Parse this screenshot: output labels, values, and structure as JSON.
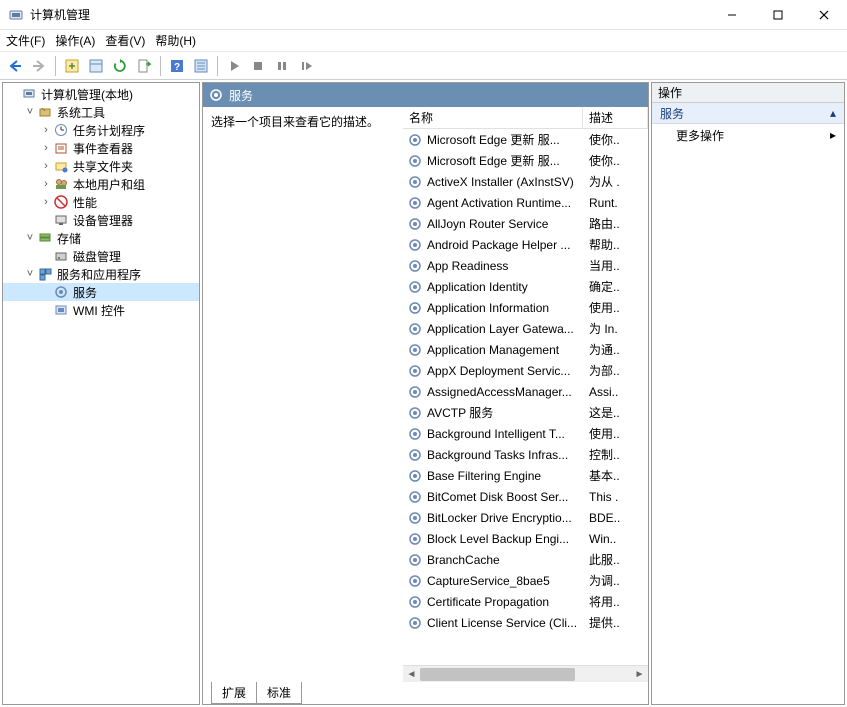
{
  "titlebar": {
    "title": "计算机管理"
  },
  "menu": {
    "file": "文件(F)",
    "action": "操作(A)",
    "view": "查看(V)",
    "help": "帮助(H)"
  },
  "tree": {
    "root": "计算机管理(本地)",
    "sys": "系统工具",
    "task": "任务计划程序",
    "event": "事件查看器",
    "shared": "共享文件夹",
    "users": "本地用户和组",
    "perf": "性能",
    "devmgr": "设备管理器",
    "storage": "存储",
    "disk": "磁盘管理",
    "apps": "服务和应用程序",
    "services": "服务",
    "wmi": "WMI 控件"
  },
  "center": {
    "header": "服务",
    "hint": "选择一个项目来查看它的描述。",
    "col_name": "名称",
    "col_desc": "描述"
  },
  "services": [
    {
      "name": "Microsoft Edge 更新 服...",
      "desc": "使你.."
    },
    {
      "name": "Microsoft Edge 更新 服...",
      "desc": "使你.."
    },
    {
      "name": "ActiveX Installer (AxInstSV)",
      "desc": "为从 ."
    },
    {
      "name": "Agent Activation Runtime...",
      "desc": "Runt."
    },
    {
      "name": "AllJoyn Router Service",
      "desc": "路由.."
    },
    {
      "name": "Android Package Helper ...",
      "desc": "帮助.."
    },
    {
      "name": "App Readiness",
      "desc": "当用.."
    },
    {
      "name": "Application Identity",
      "desc": "确定.."
    },
    {
      "name": "Application Information",
      "desc": "使用.."
    },
    {
      "name": "Application Layer Gatewa...",
      "desc": "为 In."
    },
    {
      "name": "Application Management",
      "desc": "为通.."
    },
    {
      "name": "AppX Deployment Servic...",
      "desc": "为部.."
    },
    {
      "name": "AssignedAccessManager...",
      "desc": "Assi.."
    },
    {
      "name": "AVCTP 服务",
      "desc": "这是.."
    },
    {
      "name": "Background Intelligent T...",
      "desc": "使用.."
    },
    {
      "name": "Background Tasks Infras...",
      "desc": "控制.."
    },
    {
      "name": "Base Filtering Engine",
      "desc": "基本.."
    },
    {
      "name": "BitComet Disk Boost Ser...",
      "desc": "This ."
    },
    {
      "name": "BitLocker Drive Encryptio...",
      "desc": "BDE.."
    },
    {
      "name": "Block Level Backup Engi...",
      "desc": "Win.."
    },
    {
      "name": "BranchCache",
      "desc": "此服.."
    },
    {
      "name": "CaptureService_8bae5",
      "desc": "为调.."
    },
    {
      "name": "Certificate Propagation",
      "desc": "将用.."
    },
    {
      "name": "Client License Service (Cli...",
      "desc": "提供.."
    }
  ],
  "tabs": {
    "ext": "扩展",
    "std": "标准"
  },
  "actions": {
    "header": "操作",
    "section": "服务",
    "more": "更多操作"
  }
}
